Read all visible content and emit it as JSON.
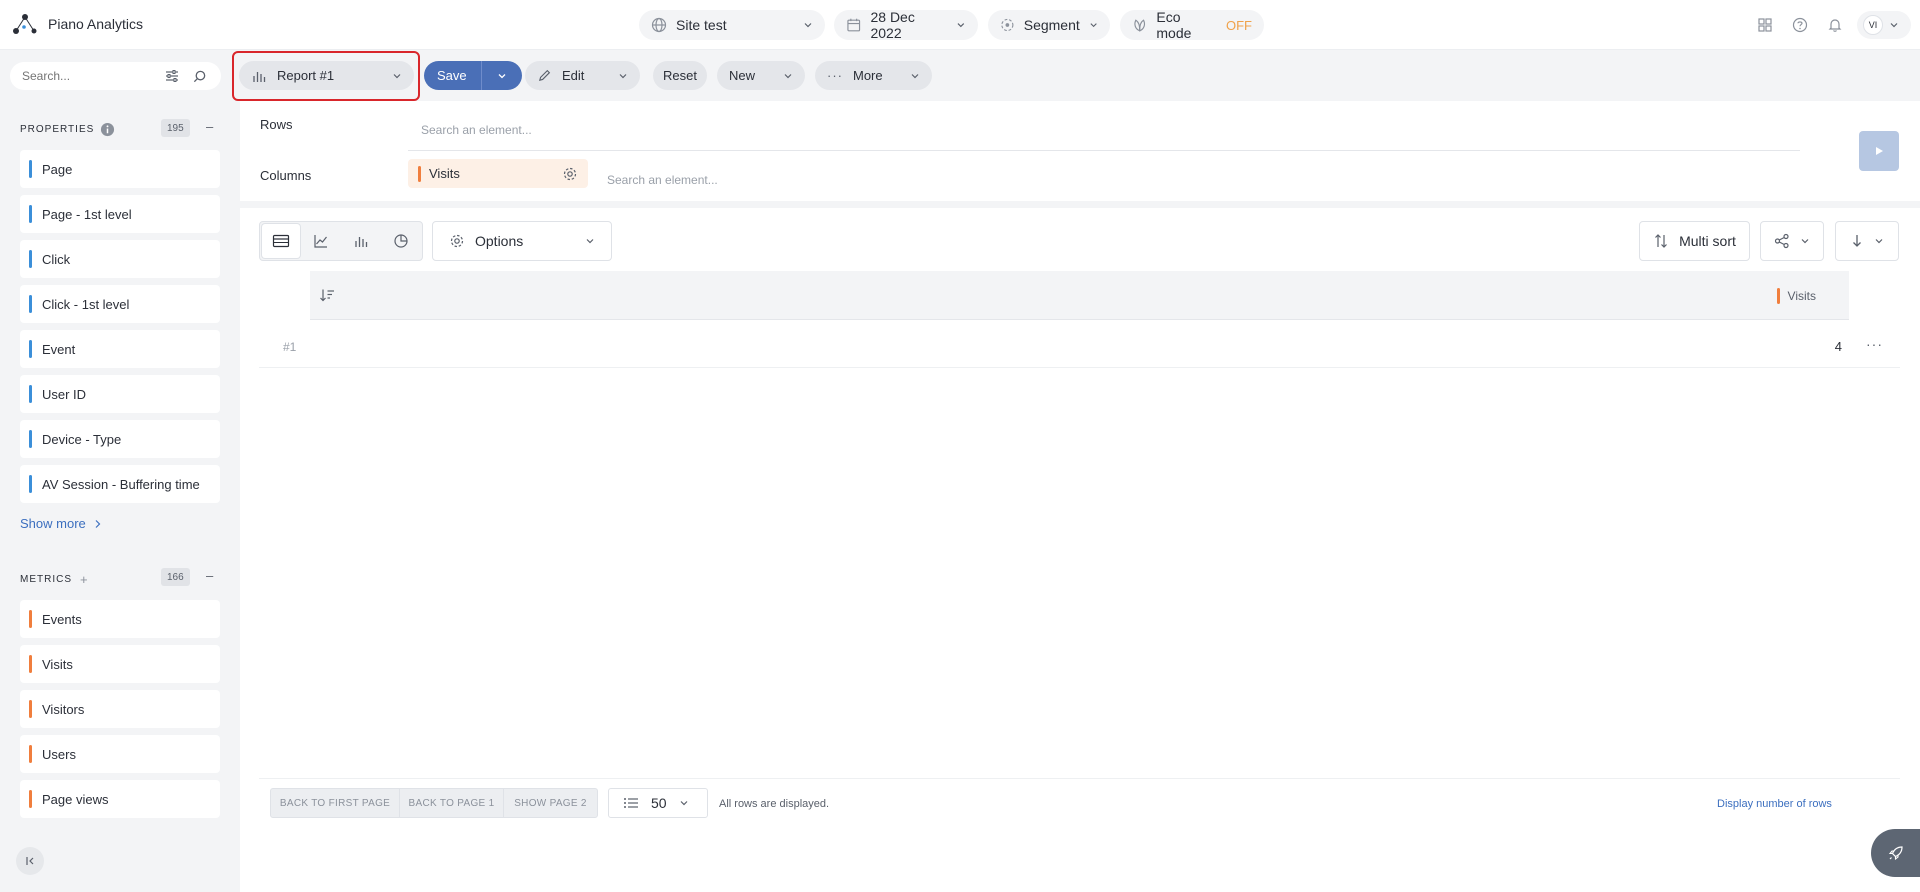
{
  "app": {
    "title": "Piano Analytics"
  },
  "topbar": {
    "site": "Site test",
    "date": "28 Dec 2022",
    "segment": "Segment",
    "eco_mode": "Eco mode",
    "eco_state": "OFF",
    "user_initials": "VI"
  },
  "sidebar": {
    "search_placeholder": "Search...",
    "properties": {
      "title": "PROPERTIES",
      "count": "195",
      "items": [
        "Page",
        "Page - 1st level",
        "Click",
        "Click - 1st level",
        "Event",
        "User ID",
        "Device - Type",
        "AV Session - Buffering time"
      ]
    },
    "show_more": "Show more",
    "metrics": {
      "title": "METRICS",
      "count": "166",
      "items": [
        "Events",
        "Visits",
        "Visitors",
        "Users",
        "Page views"
      ]
    }
  },
  "toolbar": {
    "report": "Report #1",
    "save": "Save",
    "edit": "Edit",
    "reset": "Reset",
    "new": "New",
    "more": "More"
  },
  "dropzones": {
    "rows_label": "Rows",
    "rows_placeholder": "Search an element...",
    "columns_label": "Columns",
    "column_chip": "Visits",
    "columns_placeholder": "Search an element..."
  },
  "viewbar": {
    "options": "Options",
    "multi_sort": "Multi sort"
  },
  "table": {
    "header_metric": "Visits",
    "rows": [
      {
        "index": "#1",
        "value": "4"
      }
    ]
  },
  "footer": {
    "back_first": "BACK TO FIRST PAGE",
    "back_page1": "BACK TO PAGE 1",
    "show_page2": "SHOW PAGE 2",
    "rows_per_page": "50",
    "status": "All rows are displayed.",
    "display_number": "Display number of rows"
  },
  "colors": {
    "property_accent": "#3b8fd9",
    "metric_accent": "#f07e3d",
    "primary": "#4a6fb7",
    "highlight": "#d9262b"
  }
}
